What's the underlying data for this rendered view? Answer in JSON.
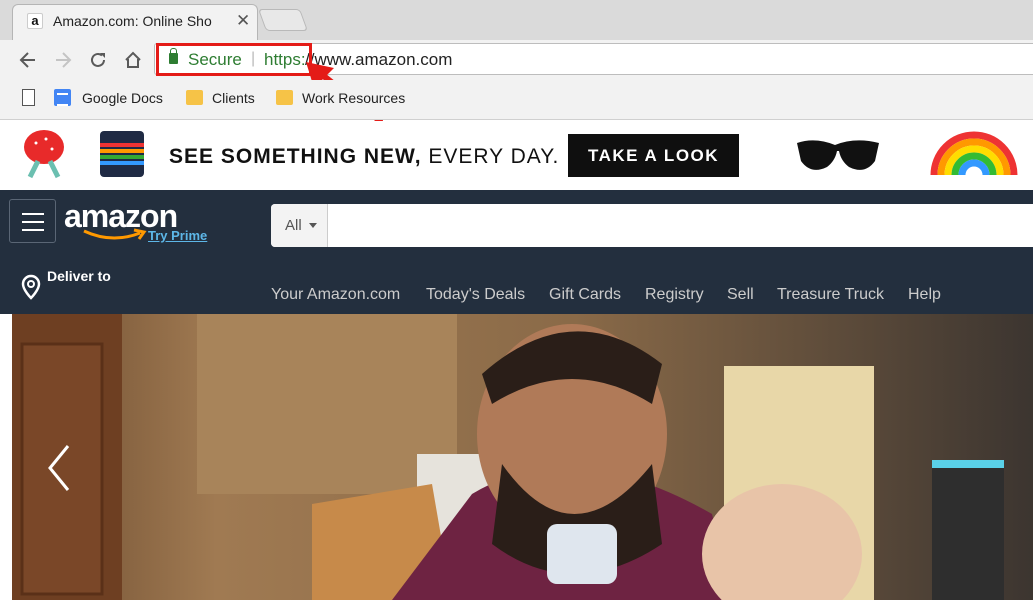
{
  "browser": {
    "tab_title": "Amazon.com: Online Sho",
    "tab_favicon": "a",
    "tab_close": "✕",
    "address": {
      "secure_label": "Secure",
      "separator": "|",
      "scheme": "https:",
      "host": "//www.amazon.com"
    },
    "bookmarks": [
      {
        "label": "Google Docs",
        "icon": "google-docs-icon"
      },
      {
        "label": "Clients",
        "icon": "folder-icon"
      },
      {
        "label": "Work Resources",
        "icon": "folder-icon"
      }
    ],
    "highlight_color": "#e41b17"
  },
  "promo": {
    "text_bold": "SEE SOMETHING NEW,",
    "text_light": " EVERY DAY.",
    "button_label": "TAKE A LOOK"
  },
  "amazon": {
    "logo": "amazon",
    "try_prime": "Try Prime",
    "search_category": "All",
    "search_value": "",
    "deliver_to": "Deliver to",
    "nav_links": [
      "Your Amazon.com",
      "Today's Deals",
      "Gift Cards",
      "Registry",
      "Sell",
      "Treasure Truck",
      "Help"
    ],
    "colors": {
      "header": "#232f3e",
      "prime_link": "#5db7e8",
      "smile": "#f90"
    }
  },
  "hero": {
    "description_icon": "chevron-left-icon"
  }
}
